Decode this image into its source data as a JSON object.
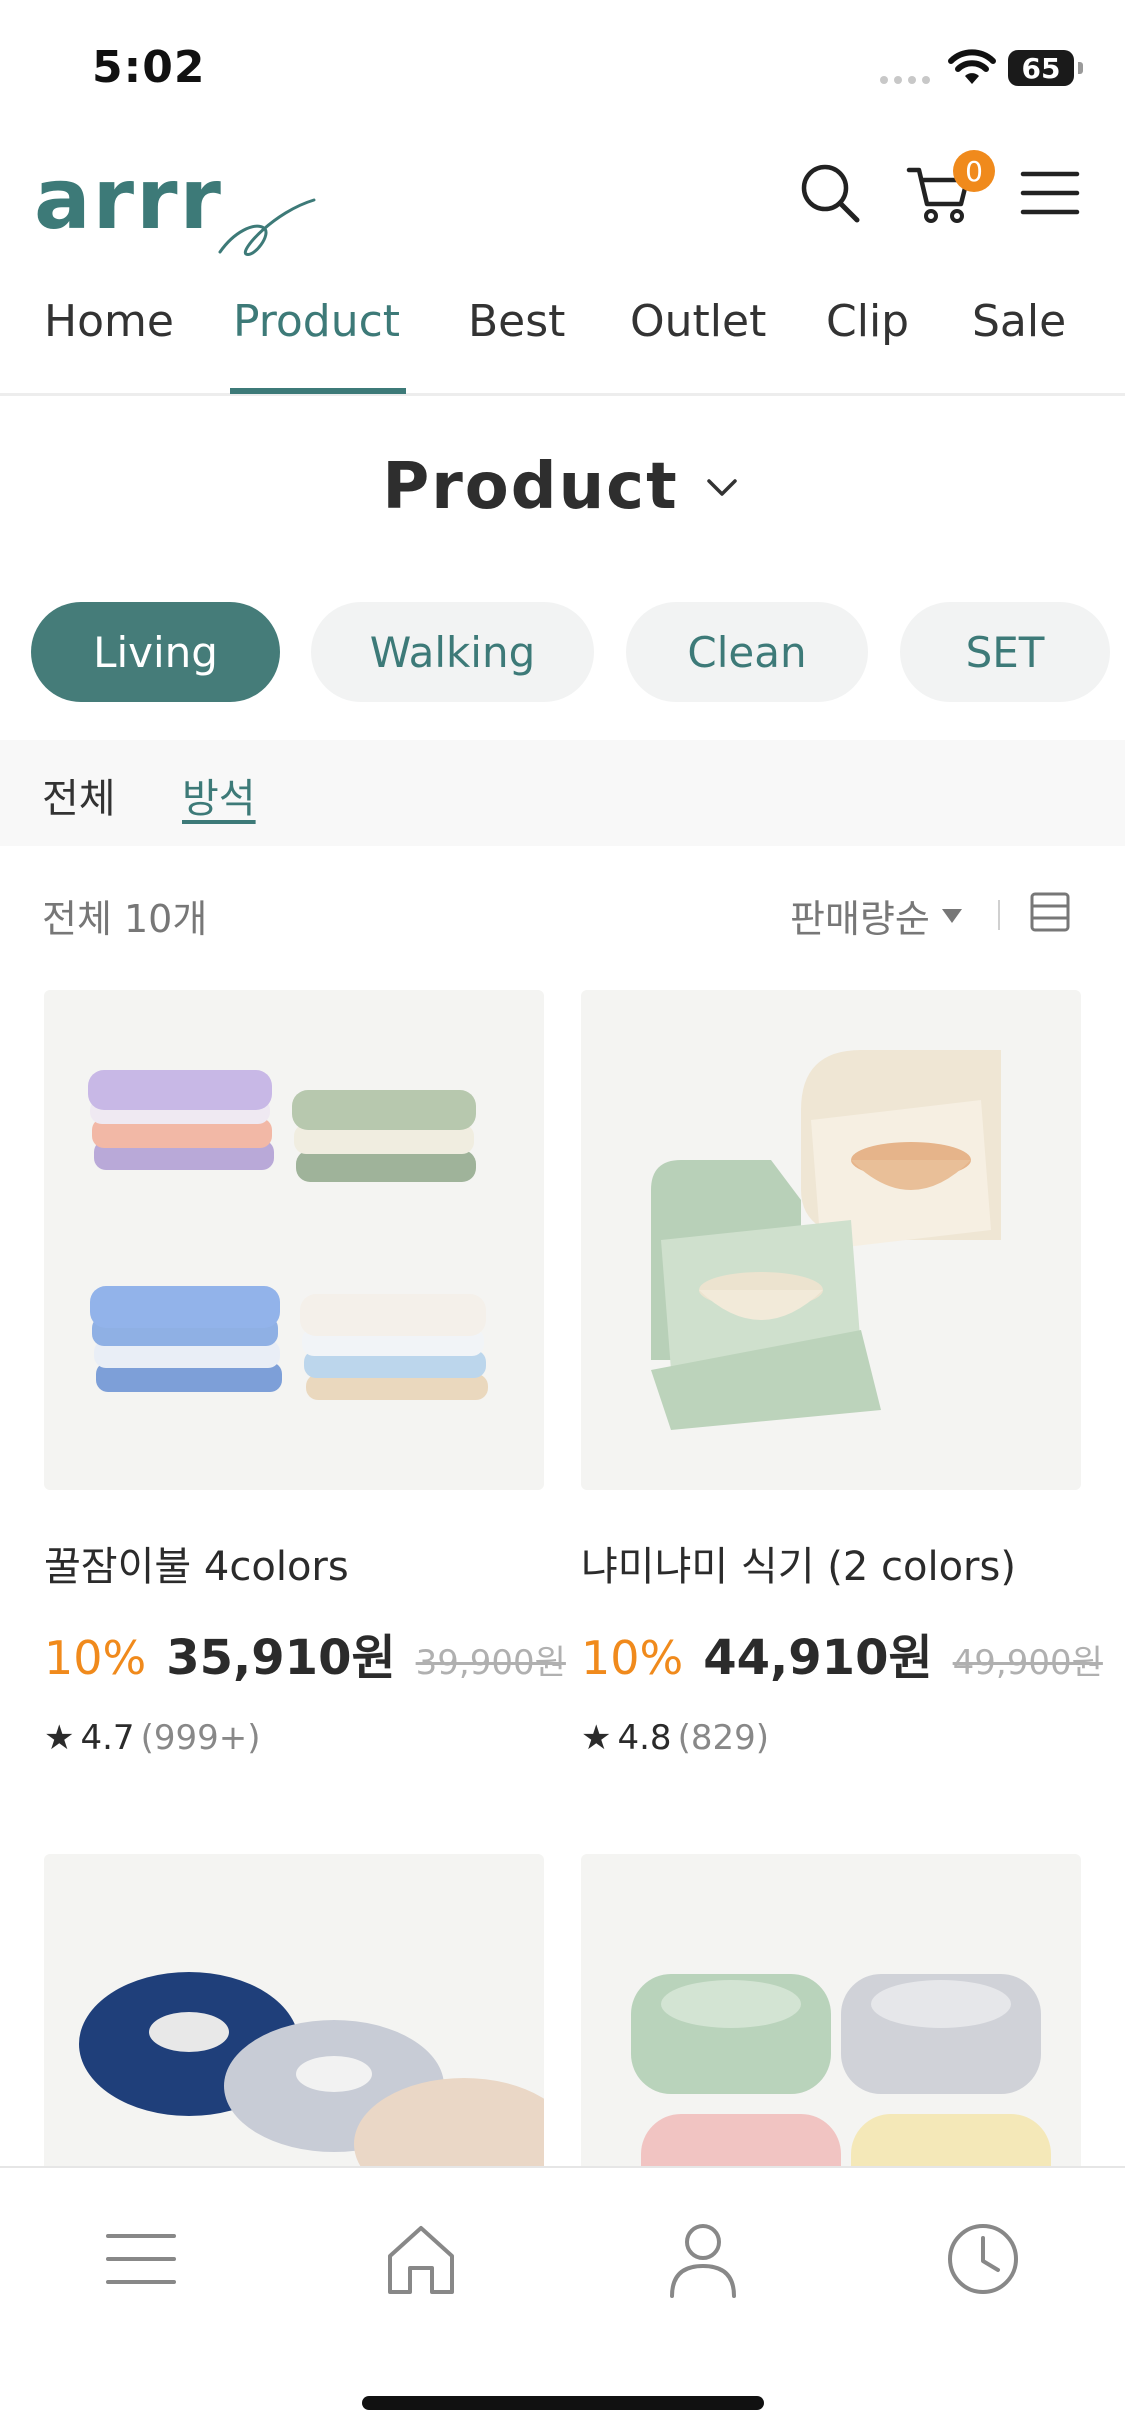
{
  "status_bar": {
    "time": "5:02",
    "battery": "65"
  },
  "header": {
    "logo_text": "arrr",
    "cart_count": "0",
    "icons": [
      "search-icon",
      "cart-icon",
      "hamburger-menu-icon"
    ]
  },
  "nav": {
    "tabs": [
      {
        "label": "Home"
      },
      {
        "label": "Product"
      },
      {
        "label": "Best"
      },
      {
        "label": "Outlet"
      },
      {
        "label": "Clip"
      },
      {
        "label": "Sale"
      }
    ],
    "active": "Product"
  },
  "page": {
    "title": "Product"
  },
  "categories": [
    {
      "label": "Living"
    },
    {
      "label": "Walking"
    },
    {
      "label": "Clean"
    },
    {
      "label": "SET"
    }
  ],
  "subfilters": [
    {
      "label": "전체"
    },
    {
      "label": "방석"
    }
  ],
  "list": {
    "count_label": "전체 10개",
    "sort_label": "판매량순"
  },
  "products": [
    {
      "name": "꿀잠이불 4colors",
      "discount": "10%",
      "price": "35,910원",
      "original_price": "39,900원",
      "rating": "4.7",
      "review_count": "(999+)"
    },
    {
      "name": "냐미냐미 식기 (2 colors)",
      "discount": "10%",
      "price": "44,910원",
      "original_price": "49,900원",
      "rating": "4.8",
      "review_count": "(829)"
    }
  ],
  "bottom_tabs": [
    "menu-icon",
    "home-icon",
    "user-icon",
    "clock-icon"
  ],
  "colors": {
    "accent": "#3d7a78",
    "discount": "#f08a1c",
    "badge": "#f08a1c"
  }
}
